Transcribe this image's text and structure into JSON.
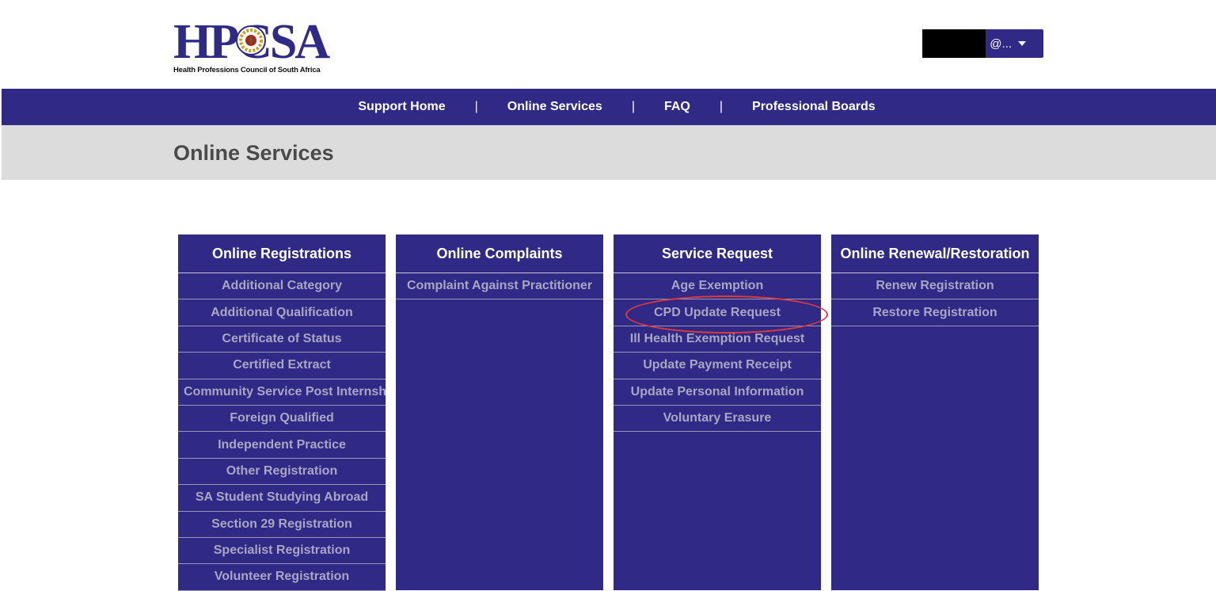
{
  "header": {
    "logo_text": "HPCSA",
    "logo_subtitle": "Health Professions Council of South Africa",
    "user_menu_label": "@...",
    "user_menu_icon": "caret-down-icon"
  },
  "nav": {
    "items": [
      {
        "label": "Support Home"
      },
      {
        "label": "Online Services"
      },
      {
        "label": "FAQ"
      },
      {
        "label": "Professional Boards"
      }
    ],
    "separator": "|"
  },
  "page": {
    "title": "Online Services"
  },
  "columns": [
    {
      "title": "Online Registrations",
      "items": [
        "Additional Category",
        "Additional Qualification",
        "Certificate of Status",
        "Certified Extract",
        "Community Service Post Internsh",
        "Foreign Qualified",
        "Independent Practice",
        "Other Registration",
        "SA Student Studying Abroad",
        "Section 29 Registration",
        "Specialist Registration",
        "Volunteer Registration"
      ]
    },
    {
      "title": "Online Complaints",
      "items": [
        "Complaint Against Practitioner"
      ]
    },
    {
      "title": "Service Request",
      "items": [
        "Age Exemption",
        "CPD Update Request",
        "Ill Health Exemption Request",
        "Update Payment Receipt",
        "Update Personal Information",
        "Voluntary Erasure"
      ]
    },
    {
      "title": "Online Renewal/Restoration",
      "items": [
        "Renew Registration",
        "Restore Registration"
      ]
    }
  ],
  "colors": {
    "brand": "#302a86",
    "title_band": "#dcdcdc",
    "highlight": "#e03a3a",
    "item_text": "#a9a6c4"
  }
}
